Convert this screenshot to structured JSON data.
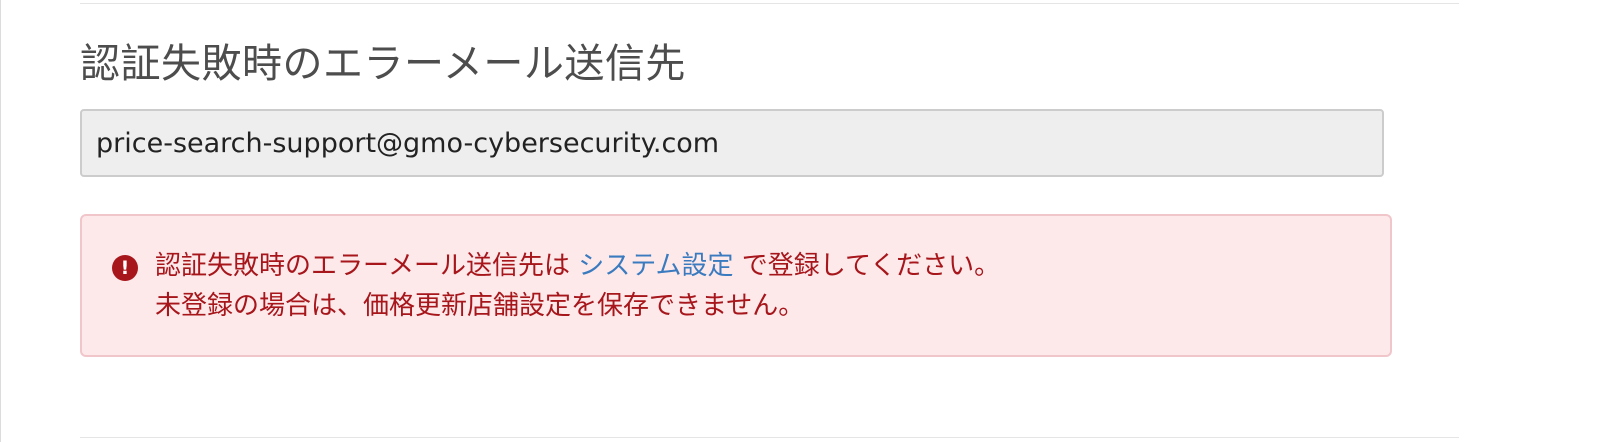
{
  "section": {
    "title": "認証失敗時のエラーメール送信先"
  },
  "email_field": {
    "value": "price-search-support@gmo-cybersecurity.com"
  },
  "alert": {
    "icon": "exclamation-circle-icon",
    "line1_prefix": "認証失敗時のエラーメール送信先は",
    "link_label": "システム設定",
    "line1_suffix": "で登録してください。",
    "line2": "未登録の場合は、価格更新店舗設定を保存できません。"
  },
  "colors": {
    "alert_background": "#fde8ea",
    "alert_text": "#a6161b",
    "link": "#3a7bbf",
    "input_background": "#eeeeee"
  }
}
